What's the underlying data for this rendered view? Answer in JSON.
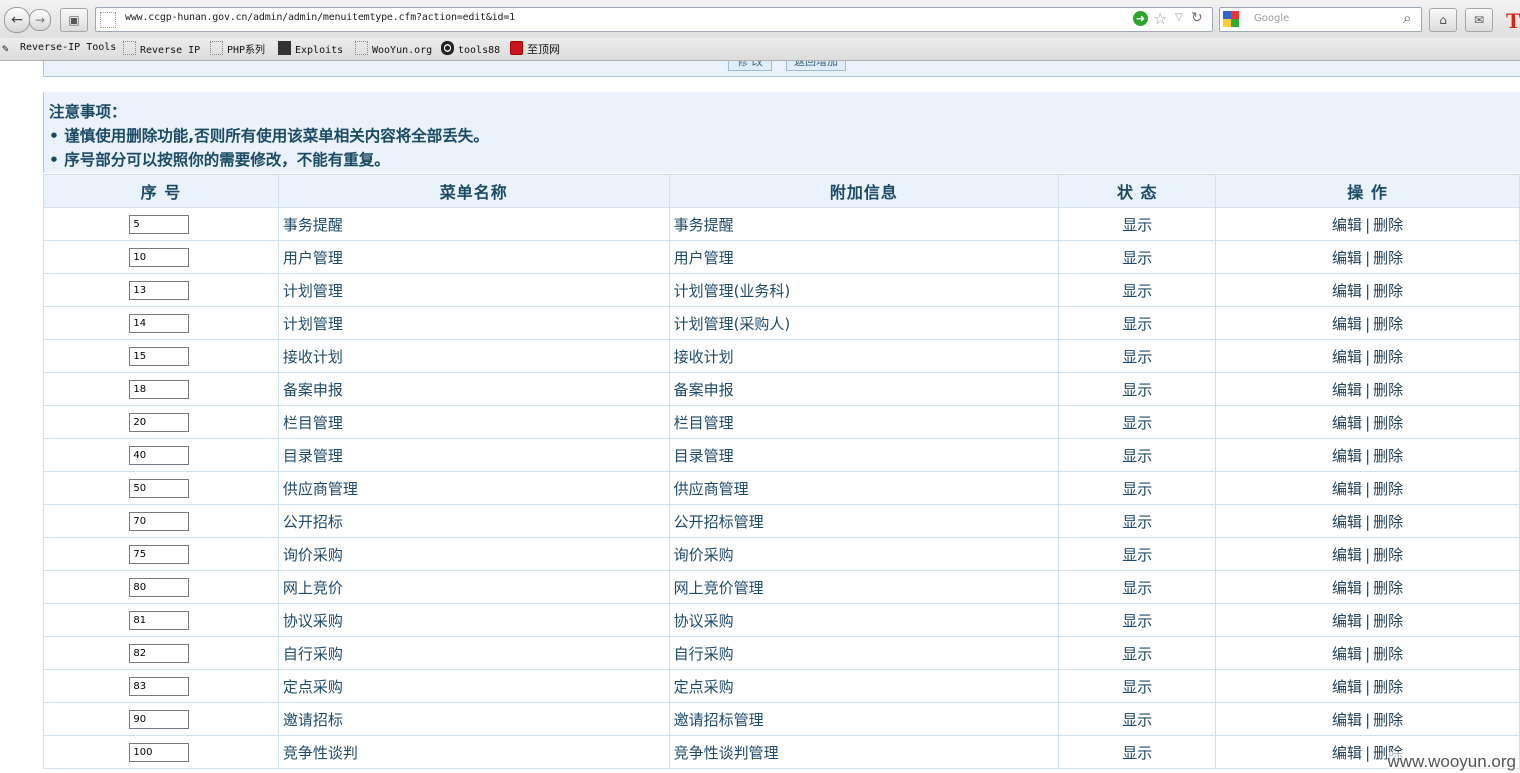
{
  "browser": {
    "url": "www.ccgp-hunan.gov.cn/admin/admin/menuitemtype.cfm?action=edit&id=1",
    "search_placeholder": "Google",
    "corner_glyph": "T"
  },
  "bookmarks": [
    {
      "label": "Reverse-IP Tools"
    },
    {
      "label": "Reverse IP"
    },
    {
      "label": "PHP系列"
    },
    {
      "label": "Exploits"
    },
    {
      "label": "WooYun.org"
    },
    {
      "label": "tools88"
    },
    {
      "label": "至顶网"
    }
  ],
  "panel": {
    "buttons": [
      "修 改",
      "返回增加"
    ]
  },
  "notes": {
    "title": "注意事项：",
    "items": [
      "• 谨慎使用删除功能,否则所有使用该菜单相关内容将全部丢失。",
      "• 序号部分可以按照你的需要修改，不能有重复。"
    ]
  },
  "table": {
    "headers": [
      "序 号",
      "菜单名称",
      "附加信息",
      "状 态",
      "操 作"
    ],
    "edit_label": "编辑",
    "delete_label": "删除",
    "separator": "|",
    "rows": [
      {
        "seq": "5",
        "name": "事务提醒",
        "info": "事务提醒",
        "state": "显示"
      },
      {
        "seq": "10",
        "name": "用户管理",
        "info": "用户管理",
        "state": "显示"
      },
      {
        "seq": "13",
        "name": "计划管理",
        "info": "计划管理(业务科)",
        "state": "显示"
      },
      {
        "seq": "14",
        "name": "计划管理",
        "info": "计划管理(采购人)",
        "state": "显示"
      },
      {
        "seq": "15",
        "name": "接收计划",
        "info": "接收计划",
        "state": "显示"
      },
      {
        "seq": "18",
        "name": "备案申报",
        "info": "备案申报",
        "state": "显示"
      },
      {
        "seq": "20",
        "name": "栏目管理",
        "info": "栏目管理",
        "state": "显示"
      },
      {
        "seq": "40",
        "name": "目录管理",
        "info": "目录管理",
        "state": "显示"
      },
      {
        "seq": "50",
        "name": "供应商管理",
        "info": "供应商管理",
        "state": "显示"
      },
      {
        "seq": "70",
        "name": "公开招标",
        "info": "公开招标管理",
        "state": "显示"
      },
      {
        "seq": "75",
        "name": "询价采购",
        "info": "询价采购",
        "state": "显示"
      },
      {
        "seq": "80",
        "name": "网上竞价",
        "info": "网上竞价管理",
        "state": "显示"
      },
      {
        "seq": "81",
        "name": "协议采购",
        "info": "协议采购",
        "state": "显示"
      },
      {
        "seq": "82",
        "name": "自行采购",
        "info": "自行采购",
        "state": "显示"
      },
      {
        "seq": "83",
        "name": "定点采购",
        "info": "定点采购",
        "state": "显示"
      },
      {
        "seq": "90",
        "name": "邀请招标",
        "info": "邀请招标管理",
        "state": "显示"
      },
      {
        "seq": "100",
        "name": "竞争性谈判",
        "info": "竞争性谈判管理",
        "state": "显示"
      }
    ]
  },
  "watermark": "www.wooyun.org"
}
